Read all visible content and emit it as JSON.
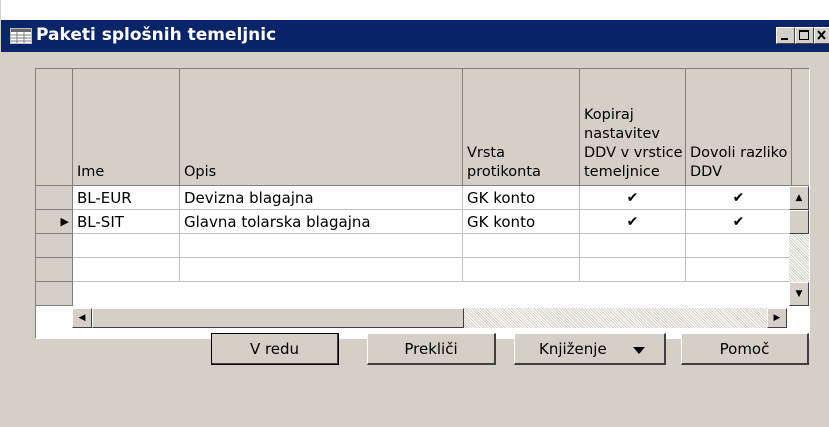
{
  "window": {
    "title": "Paketi splošnih temeljnic"
  },
  "grid": {
    "columns": [
      {
        "key": "ime",
        "label": "Ime"
      },
      {
        "key": "opis",
        "label": "Opis"
      },
      {
        "key": "vrsta",
        "label": "Vrsta protikonta"
      },
      {
        "key": "kopiraj",
        "label": "Kopiraj nastavitev DDV v vrstice temeljnice"
      },
      {
        "key": "dovoli",
        "label": "Dovoli razliko DDV"
      }
    ],
    "rows": [
      {
        "ime": "BL-EUR",
        "opis": "Devizna blagajna",
        "vrsta": "GK konto",
        "kopiraj": "✔",
        "dovoli": "✔",
        "current": false
      },
      {
        "ime": "BL-SIT",
        "opis": "Glavna tolarska blagajna",
        "vrsta": "GK konto",
        "kopiraj": "✔",
        "dovoli": "✔",
        "current": true
      },
      {
        "ime": "",
        "opis": "",
        "vrsta": "",
        "kopiraj": "",
        "dovoli": "",
        "current": false
      },
      {
        "ime": "",
        "opis": "",
        "vrsta": "",
        "kopiraj": "",
        "dovoli": "",
        "current": false
      }
    ],
    "current_row_marker": "▶"
  },
  "buttons": {
    "ok": "V redu",
    "cancel": "Prekliči",
    "posting": "Knjiženje",
    "help": "Pomoč"
  },
  "icons": {
    "window_icon": "table-icon",
    "minimize": "minimize-icon",
    "maximize": "maximize-icon",
    "close": "close-icon"
  },
  "colors": {
    "titlebar": "#0a246a",
    "face": "#d4d0c8"
  }
}
